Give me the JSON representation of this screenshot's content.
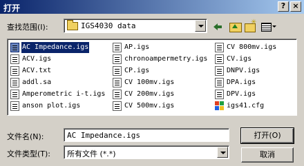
{
  "window": {
    "title": "打开",
    "help_label": "?",
    "close_label": "×"
  },
  "lookin": {
    "label": "查找范围(I):",
    "value": "IGS4030 data"
  },
  "toolbar": {
    "icons": [
      "back-icon",
      "up-folder-icon",
      "new-folder-icon",
      "view-menu-icon"
    ]
  },
  "files": {
    "col1": [
      "AC Impedance.igs",
      "ACV.igs",
      "ACV.txt",
      "addl.sa",
      "Amperometric i-t.igs",
      "anson plot.igs"
    ],
    "col2": [
      "AP.igs",
      "chronoampermetry.igs",
      "CP.igs",
      "CV 100mv.igs",
      "CV 200mv.igs",
      "CV 500mv.igs"
    ],
    "col3": [
      "CV 800mv.igs",
      "CV.igs",
      "DNPV.igs",
      "DPA.igs",
      "DPV.igs",
      "igs41.cfg"
    ],
    "selected": "AC Impedance.igs"
  },
  "filename": {
    "label": "文件名(N):",
    "value": "AC Impedance.igs"
  },
  "filetype": {
    "label": "文件类型(T):",
    "value": "所有文件 (*.*)"
  },
  "buttons": {
    "open_label": "打开(O)",
    "cancel_label": "取消"
  }
}
